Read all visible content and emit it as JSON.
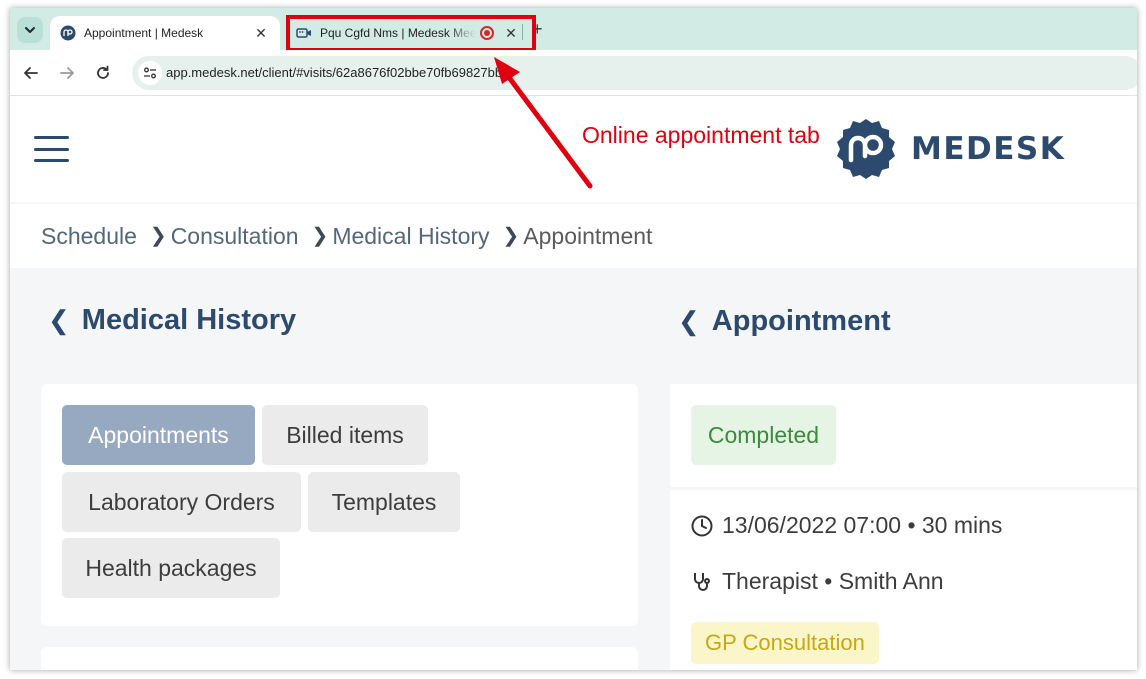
{
  "browser": {
    "tabs": [
      {
        "title": "Appointment | Medesk",
        "icon": "medesk-favicon",
        "close": "✕"
      },
      {
        "title": "Pqu Cgfd Nms | Medesk Meet",
        "icon": "video-camera-icon",
        "close": "✕",
        "recording_icon": "record-icon"
      }
    ],
    "new_tab": "+",
    "address_bar": {
      "url": "app.medesk.net/client/#visits/62a8676f02bbe70fb69827bb"
    }
  },
  "app": {
    "brand": "MEDESK",
    "brand_color": "#2c4a6e",
    "breadcrumb": [
      {
        "label": "Schedule"
      },
      {
        "label": "Consultation"
      },
      {
        "label": "Medical History"
      },
      {
        "label": "Appointment"
      }
    ],
    "left_panel": {
      "title": "Medical History",
      "tabs": [
        {
          "label": "Appointments",
          "active": true
        },
        {
          "label": "Billed items"
        },
        {
          "label": "Laboratory Orders"
        },
        {
          "label": "Templates"
        },
        {
          "label": "Health packages"
        }
      ]
    },
    "right_panel": {
      "title": "Appointment",
      "status": "Completed",
      "datetime": "13/06/2022 07:00 • 30 mins",
      "staff": "Therapist • Smith Ann",
      "type": "GP Consultation"
    }
  },
  "annotation": {
    "text": "Online appointment tab",
    "color": "#e0000f"
  }
}
